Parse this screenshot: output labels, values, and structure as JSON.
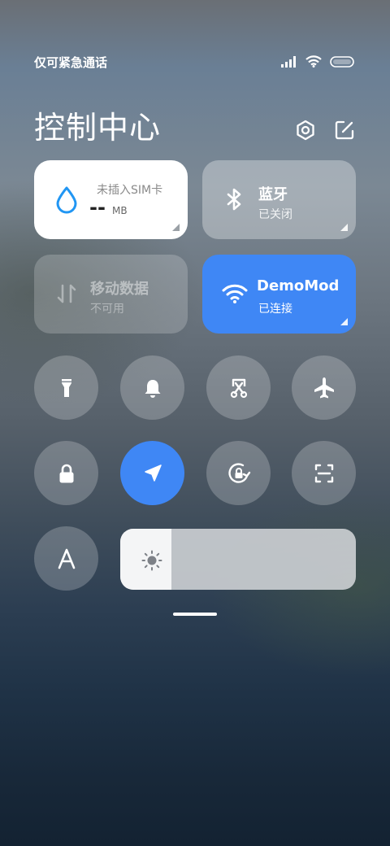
{
  "status_bar": {
    "carrier": "仅可紧急通话"
  },
  "header": {
    "title": "控制中心"
  },
  "tiles": {
    "data_usage": {
      "label": "未插入SIM卡",
      "value": "--",
      "unit": "MB"
    },
    "bluetooth": {
      "label": "蓝牙",
      "status": "已关闭"
    },
    "mobile_data": {
      "label": "移动数据",
      "status": "不可用"
    },
    "wifi": {
      "label": "DemoMod",
      "status": "已连接"
    }
  },
  "toggles_row1": [
    "flashlight-icon",
    "bell-icon",
    "screenshot-icon",
    "airplane-icon"
  ],
  "toggles_row2": [
    "lock-icon",
    "location-icon",
    "rotation-lock-icon",
    "scan-icon"
  ],
  "colors": {
    "accent": "#3f87f5",
    "drop": "#2196f3"
  },
  "brightness": {
    "level": 0.22
  }
}
